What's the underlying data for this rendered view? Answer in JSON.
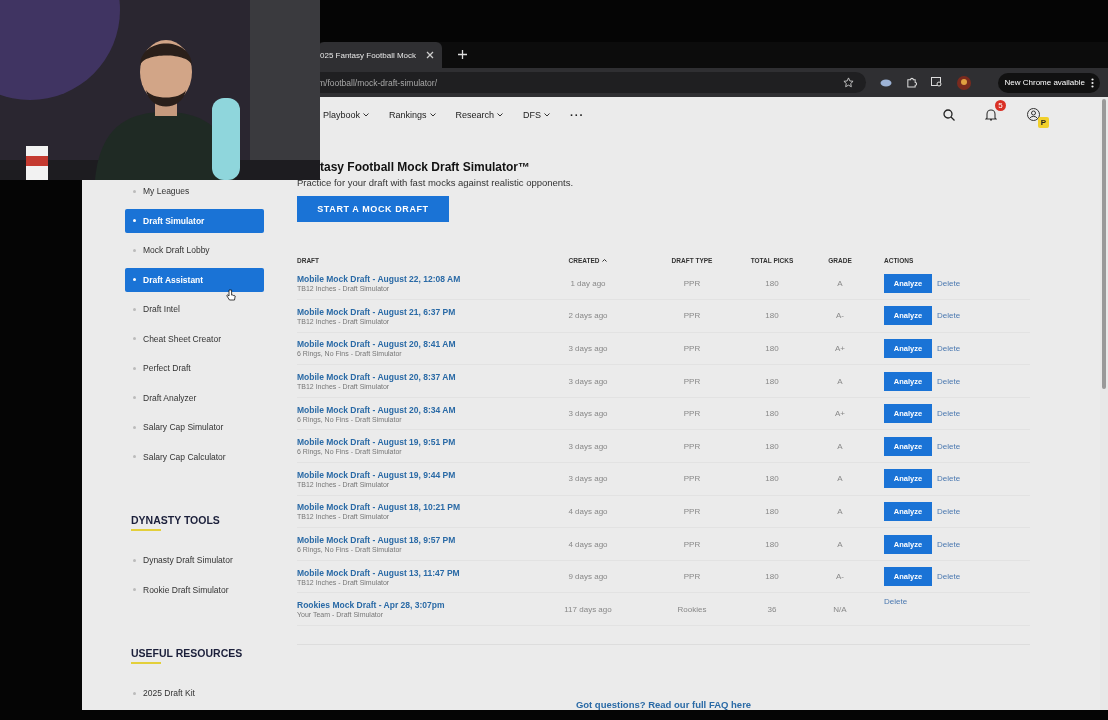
{
  "browser": {
    "tab_title": "025 Fantasy Football Mock",
    "url": "m/football/mock-draft-simulator/",
    "update_button": "New Chrome available"
  },
  "nav": {
    "items": [
      {
        "label": "Playbook"
      },
      {
        "label": "Rankings"
      },
      {
        "label": "Research"
      },
      {
        "label": "DFS"
      }
    ],
    "more": "···",
    "notification_count": "5",
    "profile_badge": "P"
  },
  "sidebar": {
    "items": [
      {
        "label": "My Leagues",
        "selected": false
      },
      {
        "label": "Draft Simulator",
        "selected": true
      },
      {
        "label": "Mock Draft Lobby",
        "selected": false
      },
      {
        "label": "Draft Assistant",
        "selected": true
      },
      {
        "label": "Draft Intel",
        "selected": false
      },
      {
        "label": "Cheat Sheet Creator",
        "selected": false
      },
      {
        "label": "Perfect Draft",
        "selected": false
      },
      {
        "label": "Draft Analyzer",
        "selected": false
      },
      {
        "label": "Salary Cap Simulator",
        "selected": false
      },
      {
        "label": "Salary Cap Calculator",
        "selected": false
      }
    ],
    "sections": [
      {
        "title": "DYNASTY TOOLS",
        "items": [
          {
            "label": "Dynasty Draft Simulator",
            "selected": false
          },
          {
            "label": "Rookie Draft Simulator",
            "selected": false
          }
        ]
      },
      {
        "title": "USEFUL RESOURCES",
        "items": [
          {
            "label": "2025 Draft Kit",
            "selected": false
          }
        ]
      }
    ]
  },
  "page": {
    "title": "tasy Football Mock Draft Simulator™",
    "subtitle": "Practice for your draft with fast mocks against realistic opponents.",
    "start_button": "START A MOCK DRAFT"
  },
  "table": {
    "columns": [
      {
        "label": "DRAFT",
        "sorted": false
      },
      {
        "label": "CREATED",
        "sorted": true
      },
      {
        "label": "DRAFT TYPE",
        "sorted": false
      },
      {
        "label": "TOTAL PICKS",
        "sorted": false
      },
      {
        "label": "GRADE",
        "sorted": false
      },
      {
        "label": "ACTIONS",
        "sorted": false
      }
    ],
    "rows": [
      {
        "title": "Mobile Mock Draft - August 22, 12:08 AM",
        "subtitle": "TB12 Inches - Draft Simulator",
        "created": "1 day ago",
        "type": "PPR",
        "picks": "180",
        "grade": "A",
        "actions": [
          {
            "label": "Analyze",
            "kind": "button"
          },
          {
            "label": "Delete",
            "kind": "link"
          }
        ]
      },
      {
        "title": "Mobile Mock Draft - August 21, 6:37 PM",
        "subtitle": "TB12 Inches - Draft Simulator",
        "created": "2 days ago",
        "type": "PPR",
        "picks": "180",
        "grade": "A-",
        "actions": [
          {
            "label": "Analyze",
            "kind": "button"
          },
          {
            "label": "Delete",
            "kind": "link"
          }
        ]
      },
      {
        "title": "Mobile Mock Draft - August 20, 8:41 AM",
        "subtitle": "6 Rings, No Fins - Draft Simulator",
        "created": "3 days ago",
        "type": "PPR",
        "picks": "180",
        "grade": "A+",
        "actions": [
          {
            "label": "Analyze",
            "kind": "button"
          },
          {
            "label": "Delete",
            "kind": "link"
          }
        ]
      },
      {
        "title": "Mobile Mock Draft - August 20, 8:37 AM",
        "subtitle": "TB12 Inches - Draft Simulator",
        "created": "3 days ago",
        "type": "PPR",
        "picks": "180",
        "grade": "A",
        "actions": [
          {
            "label": "Analyze",
            "kind": "button"
          },
          {
            "label": "Delete",
            "kind": "link"
          }
        ]
      },
      {
        "title": "Mobile Mock Draft - August 20, 8:34 AM",
        "subtitle": "6 Rings, No Fins - Draft Simulator",
        "created": "3 days ago",
        "type": "PPR",
        "picks": "180",
        "grade": "A+",
        "actions": [
          {
            "label": "Analyze",
            "kind": "button"
          },
          {
            "label": "Delete",
            "kind": "link"
          }
        ]
      },
      {
        "title": "Mobile Mock Draft - August 19, 9:51 PM",
        "subtitle": "6 Rings, No Fins - Draft Simulator",
        "created": "3 days ago",
        "type": "PPR",
        "picks": "180",
        "grade": "A",
        "actions": [
          {
            "label": "Analyze",
            "kind": "button"
          },
          {
            "label": "Delete",
            "kind": "link"
          }
        ]
      },
      {
        "title": "Mobile Mock Draft - August 19, 9:44 PM",
        "subtitle": "TB12 Inches - Draft Simulator",
        "created": "3 days ago",
        "type": "PPR",
        "picks": "180",
        "grade": "A",
        "actions": [
          {
            "label": "Analyze",
            "kind": "button"
          },
          {
            "label": "Delete",
            "kind": "link"
          }
        ]
      },
      {
        "title": "Mobile Mock Draft - August 18, 10:21 PM",
        "subtitle": "TB12 Inches - Draft Simulator",
        "created": "4 days ago",
        "type": "PPR",
        "picks": "180",
        "grade": "A",
        "actions": [
          {
            "label": "Analyze",
            "kind": "button"
          },
          {
            "label": "Delete",
            "kind": "link"
          }
        ]
      },
      {
        "title": "Mobile Mock Draft - August 18, 9:57 PM",
        "subtitle": "6 Rings, No Fins - Draft Simulator",
        "created": "4 days ago",
        "type": "PPR",
        "picks": "180",
        "grade": "A",
        "actions": [
          {
            "label": "Analyze",
            "kind": "button"
          },
          {
            "label": "Delete",
            "kind": "link"
          }
        ]
      },
      {
        "title": "Mobile Mock Draft - August 13, 11:47 PM",
        "subtitle": "TB12 Inches - Draft Simulator",
        "created": "9 days ago",
        "type": "PPR",
        "picks": "180",
        "grade": "A-",
        "actions": [
          {
            "label": "Analyze",
            "kind": "button"
          },
          {
            "label": "Delete",
            "kind": "link"
          }
        ]
      },
      {
        "title": "Rookies Mock Draft - Apr 28, 3:07pm",
        "subtitle": "Your Team - Draft Simulator",
        "created": "117 days ago",
        "type": "Rookies",
        "picks": "36",
        "grade": "N/A",
        "actions": [
          {
            "label": "Delete",
            "kind": "link"
          }
        ]
      }
    ]
  },
  "faq_link": "Got questions? Read our full FAQ here"
}
